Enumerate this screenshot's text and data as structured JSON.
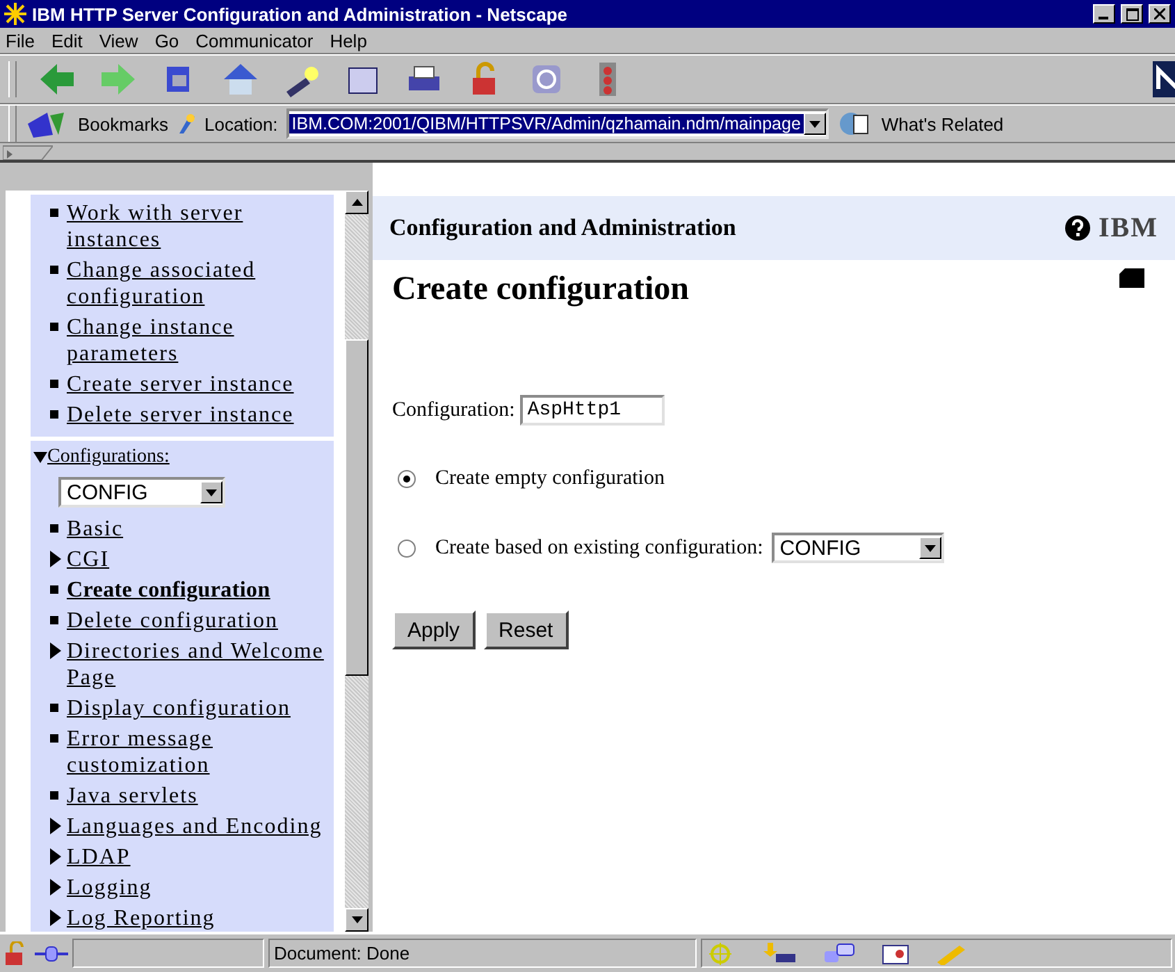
{
  "window": {
    "title": "IBM HTTP Server Configuration and Administration - Netscape"
  },
  "menu": [
    "File",
    "Edit",
    "View",
    "Go",
    "Communicator",
    "Help"
  ],
  "location_bar": {
    "bookmarks": "Bookmarks",
    "label": "Location:",
    "url": "IBM.COM:2001/QIBM/HTTPSVR/Admin/qzhamain.ndm/mainpage",
    "related": "What's Related"
  },
  "sidebar": {
    "sections": [
      {
        "items": [
          {
            "label": "Work with server instances",
            "kind": "bullet",
            "selected": false
          },
          {
            "label": "Change associated configuration",
            "kind": "bullet",
            "selected": false
          },
          {
            "label": "Change instance parameters",
            "kind": "bullet",
            "selected": false
          },
          {
            "label": "Create server instance",
            "kind": "bullet",
            "selected": false
          },
          {
            "label": "Delete server instance",
            "kind": "bullet",
            "selected": false
          }
        ]
      },
      {
        "heading": "Configurations:",
        "expanded": true,
        "select": "CONFIG",
        "items": [
          {
            "label": "Basic",
            "kind": "bullet",
            "selected": false
          },
          {
            "label": "CGI",
            "kind": "arrow",
            "selected": false
          },
          {
            "label": "Create configuration",
            "kind": "bullet",
            "selected": true
          },
          {
            "label": "Delete configuration",
            "kind": "bullet",
            "selected": false
          },
          {
            "label": "Directories and Welcome Page",
            "kind": "arrow",
            "selected": false
          },
          {
            "label": "Display configuration",
            "kind": "bullet",
            "selected": false
          },
          {
            "label": "Error message customization",
            "kind": "bullet",
            "selected": false
          },
          {
            "label": "Java servlets",
            "kind": "bullet",
            "selected": false
          },
          {
            "label": "Languages and Encoding",
            "kind": "arrow",
            "selected": false
          },
          {
            "label": "LDAP",
            "kind": "arrow",
            "selected": false
          },
          {
            "label": "Logging",
            "kind": "arrow",
            "selected": false
          },
          {
            "label": "Log Reporting",
            "kind": "arrow",
            "selected": false
          }
        ]
      }
    ]
  },
  "main": {
    "header": "Configuration and Administration",
    "logo": "IBM",
    "page_title": "Create configuration",
    "config_field": {
      "label": "Configuration:",
      "value": "AspHttp1"
    },
    "options": [
      {
        "label": "Create empty configuration",
        "selected": true
      },
      {
        "label": "Create based on existing configuration:",
        "selected": false,
        "select": "CONFIG"
      }
    ],
    "buttons": [
      "Apply",
      "Reset"
    ]
  },
  "status_bar": {
    "text": "Document: Done"
  }
}
